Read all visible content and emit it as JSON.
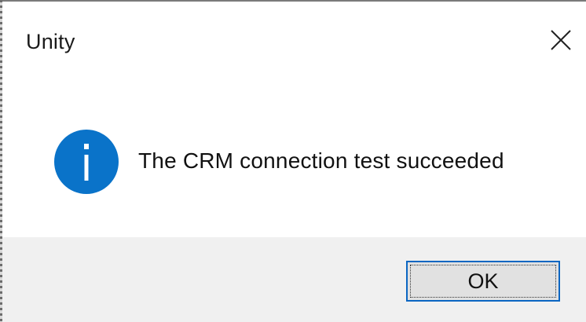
{
  "window": {
    "title": "Unity",
    "close_icon": "close-icon"
  },
  "message": {
    "icon": "info-icon",
    "text": "The CRM connection test succeeded"
  },
  "buttons": {
    "ok_label": "OK"
  },
  "colors": {
    "info_icon_bg": "#0a73c9",
    "button_focus_border": "#0a66c2",
    "footer_bg": "#f0f0f0"
  }
}
